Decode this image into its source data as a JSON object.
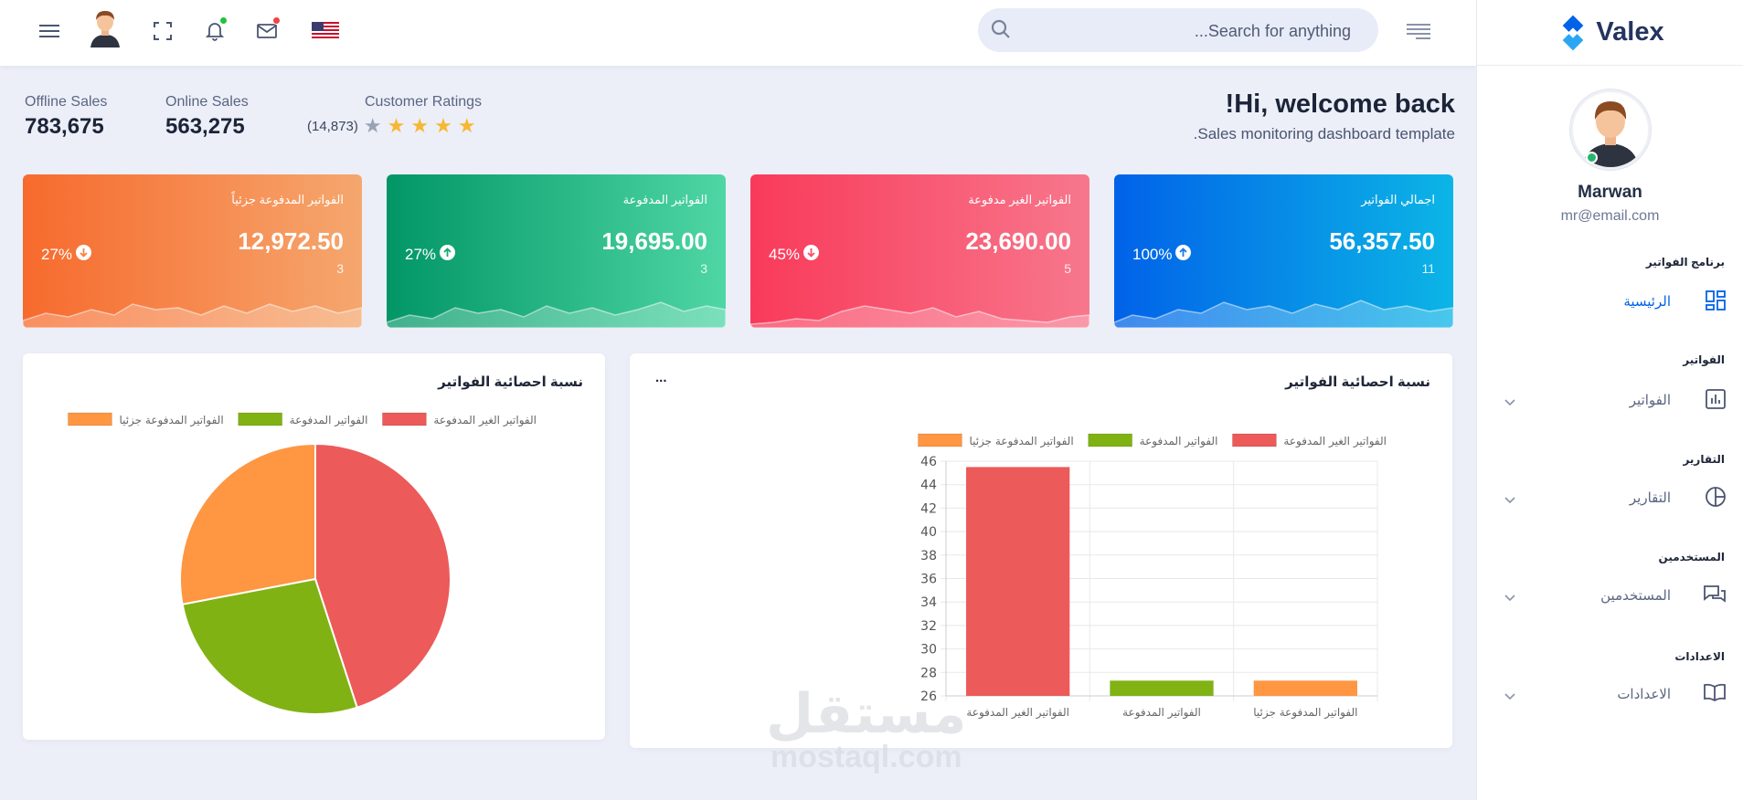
{
  "header": {
    "search_placeholder": "Search for anything...",
    "flag": "us-flag",
    "icons": [
      "menu-icon",
      "avatar",
      "fullscreen-icon",
      "bell-icon",
      "mail-icon",
      "us-flag-icon",
      "align-right-icon",
      "search-icon"
    ],
    "notification_color": "#22c03c",
    "mail_dot_color": "#f34343"
  },
  "sidebar": {
    "logo_text": "Valex",
    "user_name": "Marwan",
    "user_email": "mr@email.com",
    "sections": [
      {
        "category": "برنامج الفواتير",
        "item": "الرئيسية",
        "icon": "dashboard-icon",
        "active": true
      },
      {
        "category": "الفواتير",
        "item": "الفواتير",
        "icon": "bar-chart-icon",
        "active": false
      },
      {
        "category": "التقارير",
        "item": "التقارير",
        "icon": "pie-chart-icon",
        "active": false
      },
      {
        "category": "المستخدمين",
        "item": "المستخدمين",
        "icon": "chat-icon",
        "active": false
      },
      {
        "category": "الاعدادات",
        "item": "الاعدادات",
        "icon": "book-icon",
        "active": false
      }
    ]
  },
  "welcome": {
    "title": "Hi, welcome back!",
    "subtitle": "Sales monitoring dashboard template."
  },
  "stats": {
    "offline_label": "Offline Sales",
    "offline_value": "783,675",
    "online_label": "Online Sales",
    "online_value": "563,275",
    "ratings_label": "Customer Ratings",
    "ratings_count": "(14,873)",
    "rating_stars": 4
  },
  "cards": [
    {
      "title": "اجمالي الفواتير",
      "value": "56,357.50",
      "count": "11",
      "percent": "100%",
      "trend": "up",
      "color_from": "#0162e8",
      "color_to": "#0cb5e6"
    },
    {
      "title": "الفواتير الغير مدفوعة",
      "value": "23,690.00",
      "count": "5",
      "percent": "45%",
      "trend": "down",
      "color_from": "#f93a5a",
      "color_to": "#f7778c"
    },
    {
      "title": "الفواتير المدفوعة",
      "value": "19,695.00",
      "count": "3",
      "percent": "27%",
      "trend": "up",
      "color_from": "#029666",
      "color_to": "#4fd6a5"
    },
    {
      "title": "الفواتير المدفوعة جزئياً",
      "value": "12,972.50",
      "count": "3",
      "percent": "27%",
      "trend": "down",
      "color_from": "#f76a2d",
      "color_to": "#f5a76e"
    }
  ],
  "bar_panel": {
    "title": "نسبة احصائية الفواتير",
    "more": "..."
  },
  "pie_panel": {
    "title": "نسبة احصائية الفواتير"
  },
  "watermark": {
    "arabic": "مستقل",
    "latin": "mostaql.com"
  },
  "chart_data": [
    {
      "type": "bar",
      "title": "نسبة احصائية الفواتير",
      "categories": [
        "الفواتير الغير المدفوعة",
        "الفواتير المدفوعة",
        "الفواتير المدفوعة جزئيا"
      ],
      "series": [
        {
          "name": "الفواتير الغير المدفوعة",
          "color": "#ec5a5a",
          "values": [
            45.5,
            null,
            null
          ]
        },
        {
          "name": "الفواتير المدفوعة",
          "color": "#81b214",
          "values": [
            null,
            27.3,
            null
          ]
        },
        {
          "name": "الفواتير المدفوعة جزئيا",
          "color": "#ff9642",
          "values": [
            null,
            null,
            27.3
          ]
        }
      ],
      "ylim": [
        26,
        46
      ],
      "yticks": [
        26,
        28,
        30,
        32,
        34,
        36,
        38,
        40,
        42,
        44,
        46
      ],
      "legend": "top",
      "grid": true
    },
    {
      "type": "pie",
      "title": "نسبة احصائية الفواتير",
      "labels": [
        "الفواتير الغير المدفوعة",
        "الفواتير المدفوعة",
        "الفواتير المدفوعة جزئيا"
      ],
      "values": [
        45,
        27,
        28
      ],
      "colors": [
        "#ec5a5a",
        "#81b214",
        "#ff9642"
      ],
      "legend": "top"
    }
  ]
}
